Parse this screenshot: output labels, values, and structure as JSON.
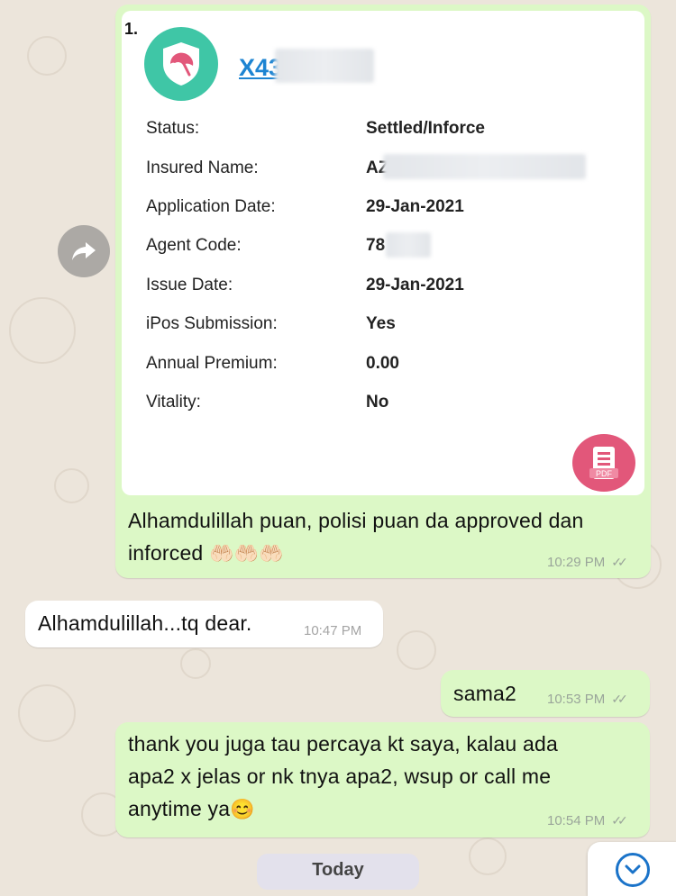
{
  "policy_card": {
    "index": "1.",
    "policy_number_prefix": "X43",
    "rows": [
      {
        "label": "Status:",
        "value": "Settled/Inforce"
      },
      {
        "label": "Insured Name:",
        "value": "AZ"
      },
      {
        "label": "Application Date:",
        "value": "29-Jan-2021"
      },
      {
        "label": "Agent Code:",
        "value": "78"
      },
      {
        "label": "Issue Date:",
        "value": "29-Jan-2021"
      },
      {
        "label": "iPos Submission:",
        "value": "Yes"
      },
      {
        "label": "Annual Premium:",
        "value": "0.00"
      },
      {
        "label": "Vitality:",
        "value": "No"
      }
    ],
    "pdf_label": "PDF"
  },
  "messages": [
    {
      "direction": "outgoing",
      "text_line1": "Alhamdulillah puan, polisi puan da approved dan",
      "text_line2": "inforced",
      "emoji": "🤲🏻🤲🏻🤲🏻",
      "time": "10:29 PM",
      "ticks": "✓✓"
    },
    {
      "direction": "incoming",
      "text": "Alhamdulillah...tq dear.",
      "time": "10:47 PM"
    },
    {
      "direction": "outgoing",
      "text": "sama2",
      "time": "10:53 PM",
      "ticks": "✓✓"
    },
    {
      "direction": "outgoing",
      "text_line1": "thank you juga tau percaya kt saya, kalau ada",
      "text_line2": "apa2 x jelas or nk tnya apa2, wsup or call me",
      "text_line3": "anytime ya",
      "emoji": "😊",
      "time": "10:54 PM",
      "ticks": "✓✓"
    }
  ],
  "date_separator": "Today",
  "colors": {
    "outgoing_bubble": "#dcf8c6",
    "incoming_bubble": "#ffffff",
    "link": "#1d84d2",
    "logo_bg": "#3fc6a6",
    "pdf_bg": "#e2577a",
    "scroll_accent": "#1a73c9"
  },
  "icons": {
    "logo": "shield-umbrella-icon",
    "pdf": "pdf-document-icon",
    "forward": "forward-arrow-icon",
    "scroll": "chevron-down-icon"
  }
}
